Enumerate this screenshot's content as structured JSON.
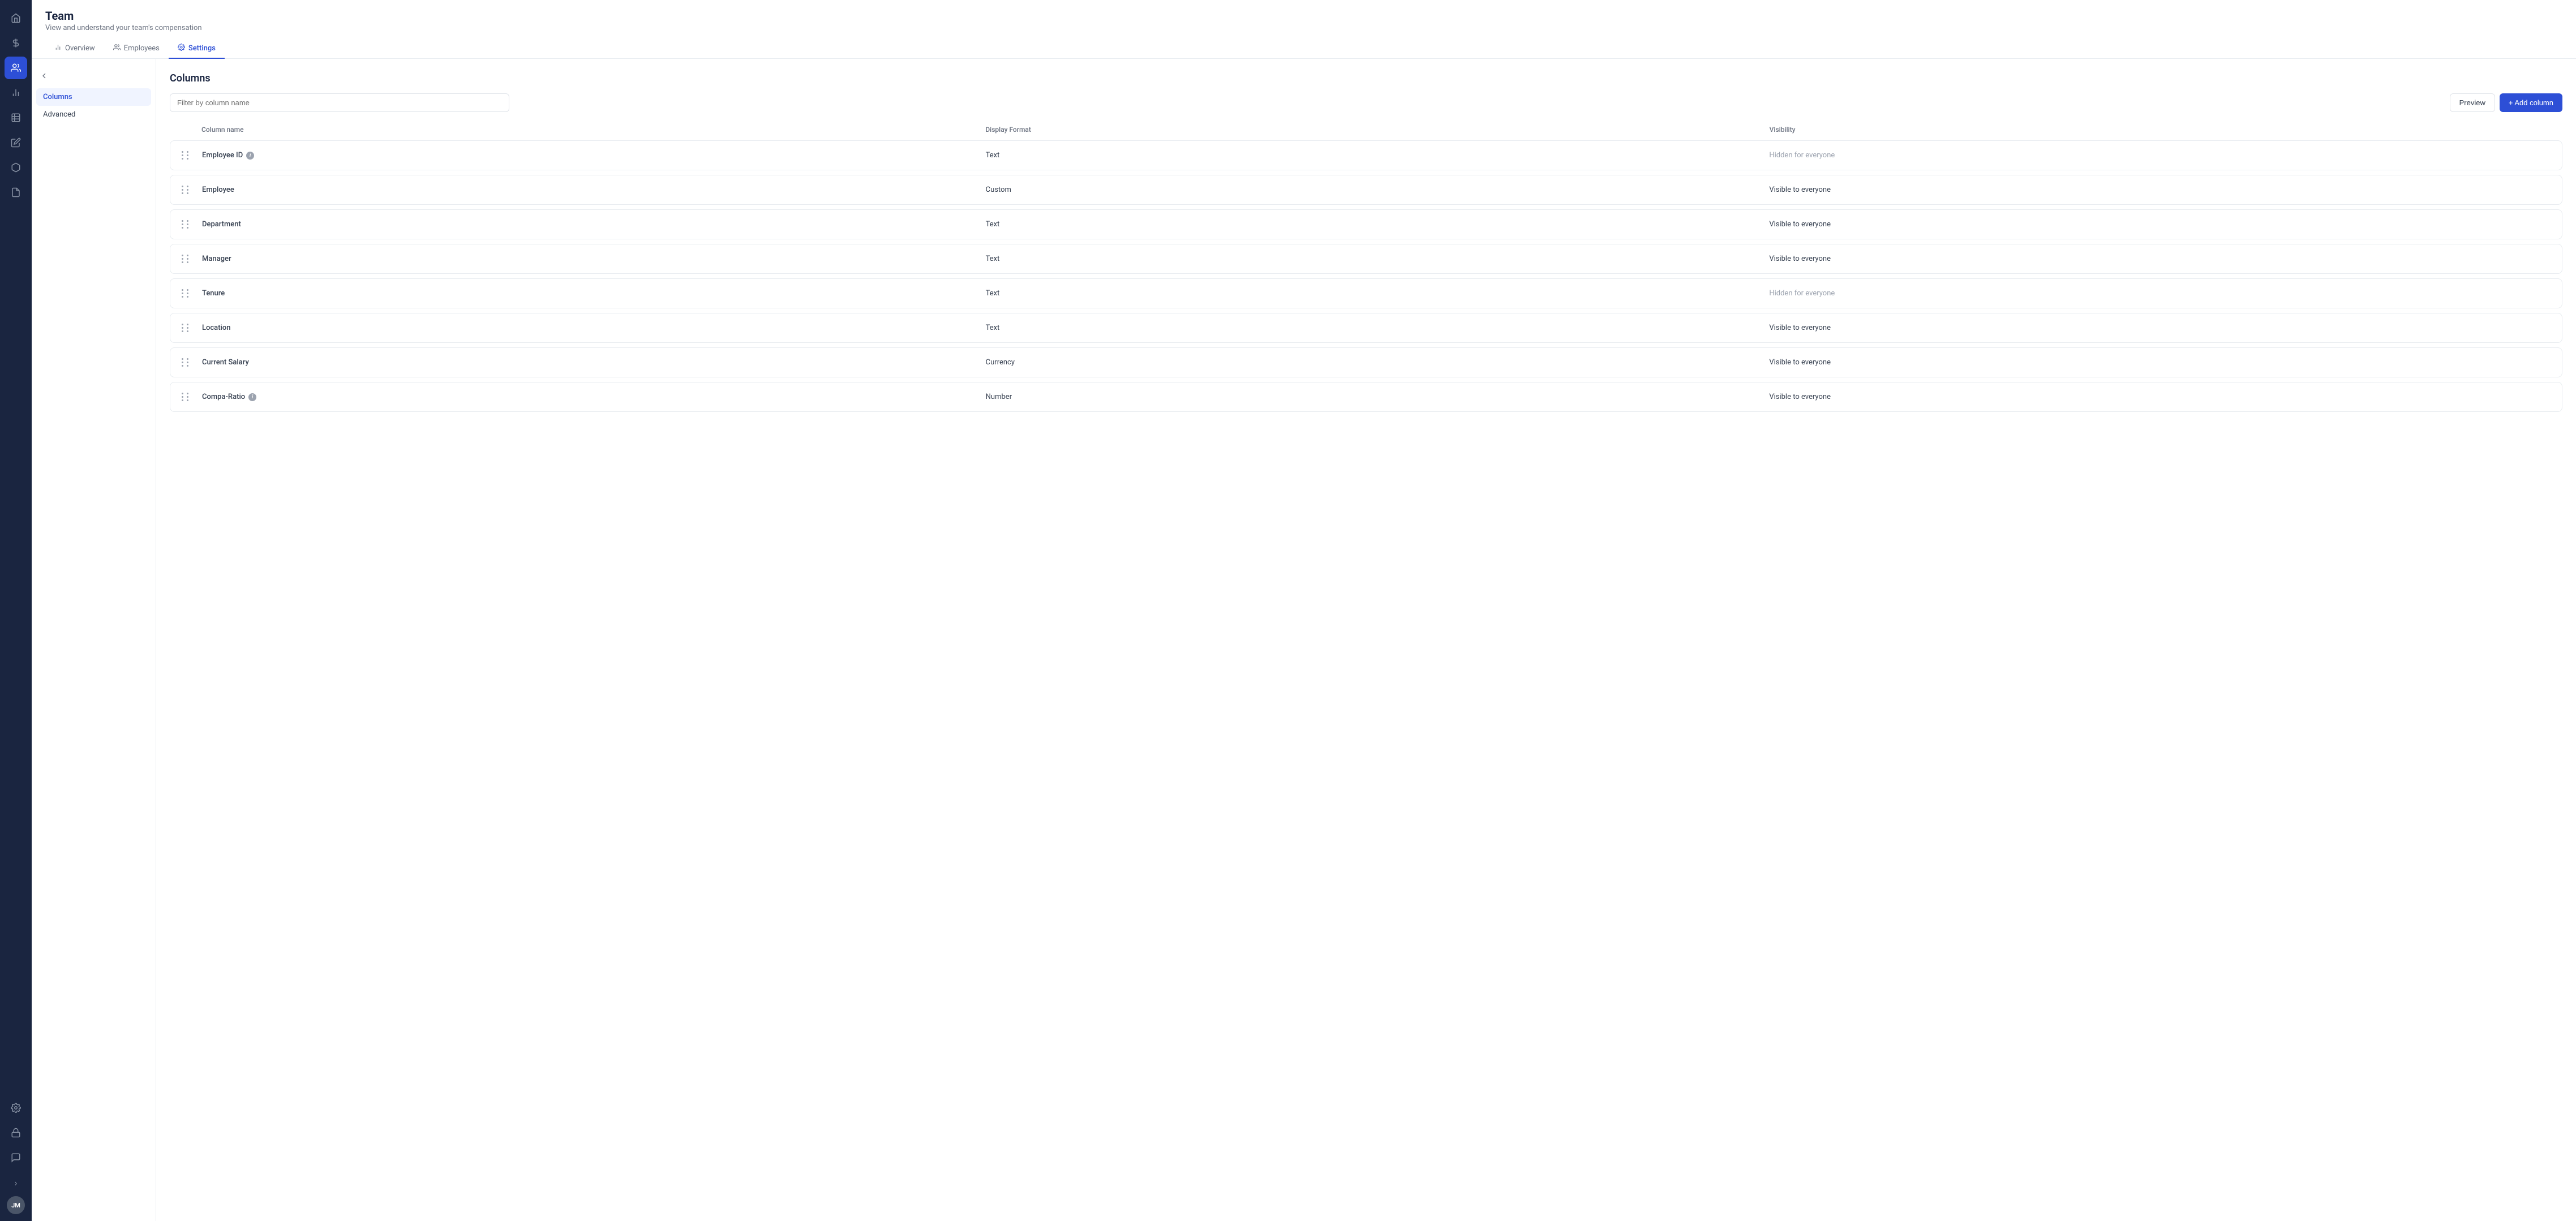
{
  "app": {
    "title": "Team",
    "subtitle": "View and understand your team's compensation"
  },
  "tabs": [
    {
      "id": "overview",
      "label": "Overview",
      "icon": "📊",
      "active": false
    },
    {
      "id": "employees",
      "label": "Employees",
      "icon": "👥",
      "active": false
    },
    {
      "id": "settings",
      "label": "Settings",
      "icon": "⚙️",
      "active": true
    }
  ],
  "sidebar_nav": {
    "items": [
      {
        "id": "home",
        "icon": "🏠",
        "active": false
      },
      {
        "id": "balance",
        "icon": "⚖️",
        "active": false
      },
      {
        "id": "person",
        "icon": "👤",
        "active": true
      },
      {
        "id": "chart",
        "icon": "📈",
        "active": false
      },
      {
        "id": "table",
        "icon": "📋",
        "active": false
      },
      {
        "id": "edit",
        "icon": "✏️",
        "active": false
      },
      {
        "id": "package",
        "icon": "📦",
        "active": false
      },
      {
        "id": "document",
        "icon": "📄",
        "active": false
      },
      {
        "id": "settings",
        "icon": "⚙️",
        "active": false
      },
      {
        "id": "lock",
        "icon": "🔒",
        "active": false
      }
    ],
    "bottom_items": [
      {
        "id": "chat",
        "icon": "💬"
      },
      {
        "id": "expand",
        "icon": "›"
      }
    ],
    "avatar": {
      "label": "JM"
    }
  },
  "left_nav": {
    "items": [
      {
        "id": "columns",
        "label": "Columns",
        "active": true
      },
      {
        "id": "advanced",
        "label": "Advanced",
        "active": false
      }
    ]
  },
  "columns_section": {
    "title": "Columns",
    "filter_placeholder": "Filter by column name",
    "preview_label": "Preview",
    "add_column_label": "+ Add column",
    "table_headers": {
      "column_name": "Column name",
      "display_format": "Display Format",
      "visibility": "Visibility"
    },
    "columns": [
      {
        "id": 1,
        "name": "Employee ID",
        "has_info": true,
        "format": "Text",
        "visibility": "Hidden for everyone",
        "hidden": true
      },
      {
        "id": 2,
        "name": "Employee",
        "has_info": false,
        "format": "Custom",
        "visibility": "Visible to everyone",
        "hidden": false
      },
      {
        "id": 3,
        "name": "Department",
        "has_info": false,
        "format": "Text",
        "visibility": "Visible to everyone",
        "hidden": false
      },
      {
        "id": 4,
        "name": "Manager",
        "has_info": false,
        "format": "Text",
        "visibility": "Visible to everyone",
        "hidden": false
      },
      {
        "id": 5,
        "name": "Tenure",
        "has_info": false,
        "format": "Text",
        "visibility": "Hidden for everyone",
        "hidden": true
      },
      {
        "id": 6,
        "name": "Location",
        "has_info": false,
        "format": "Text",
        "visibility": "Visible to everyone",
        "hidden": false
      },
      {
        "id": 7,
        "name": "Current Salary",
        "has_info": false,
        "format": "Currency",
        "visibility": "Visible to everyone",
        "hidden": false
      },
      {
        "id": 8,
        "name": "Compa-Ratio",
        "has_info": true,
        "format": "Number",
        "visibility": "Visible to everyone",
        "hidden": false
      }
    ]
  },
  "colors": {
    "primary": "#2d4fd6",
    "sidebar_bg": "#1a2540",
    "active_item": "#f0f4ff"
  }
}
